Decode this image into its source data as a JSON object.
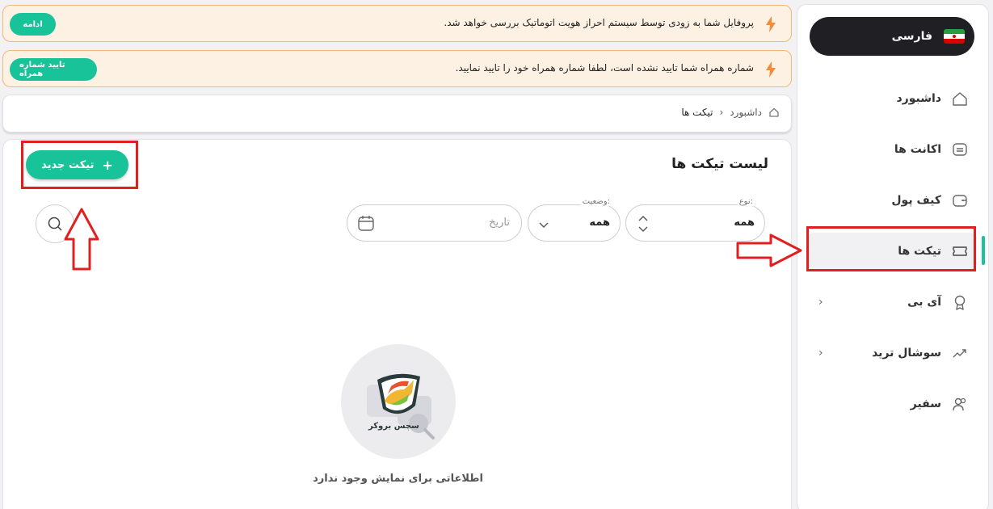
{
  "alerts": [
    {
      "message": "پروفایل شما به زودی توسط سیستم احراز هویت اتوماتیک بررسی خواهد شد.",
      "button": "ادامه"
    },
    {
      "message": "شماره همراه شما تایید نشده است، لطفا شماره همراه خود را تایید نمایید.",
      "button": "تایید شماره همراه"
    }
  ],
  "breadcrumb": {
    "home": "داشبورد",
    "separator": "›",
    "current": "تیکت ها"
  },
  "page": {
    "title": "لیست تیکت ها",
    "new_ticket_label": "تیکت جدید",
    "new_ticket_icon": "+",
    "filters": {
      "type": {
        "label": "نوع:",
        "value": "همه"
      },
      "status": {
        "label": "وضعیت:",
        "value": "همه"
      },
      "date": {
        "placeholder": "تاریخ"
      }
    },
    "empty_message": "اطلاعاتی برای نمایش وجود ندارد",
    "logo_text": "سچس بروکر"
  },
  "sidebar": {
    "language": "فارسی",
    "items": [
      {
        "label": "داشبورد",
        "icon": "home-icon"
      },
      {
        "label": "اکانت ها",
        "icon": "account-card-icon"
      },
      {
        "label": "کیف پول",
        "icon": "wallet-icon"
      },
      {
        "label": "تیکت ها",
        "icon": "ticket-icon"
      },
      {
        "label": "آی بی",
        "icon": "award-icon"
      },
      {
        "label": "سوشال ترید",
        "icon": "trend-icon"
      },
      {
        "label": "سفیر",
        "icon": "users-icon"
      }
    ]
  },
  "colors": {
    "accent": "#19c39a",
    "annotation": "#e02020",
    "alert_bg": "#fdf1e3",
    "alert_border": "#f1b877"
  }
}
